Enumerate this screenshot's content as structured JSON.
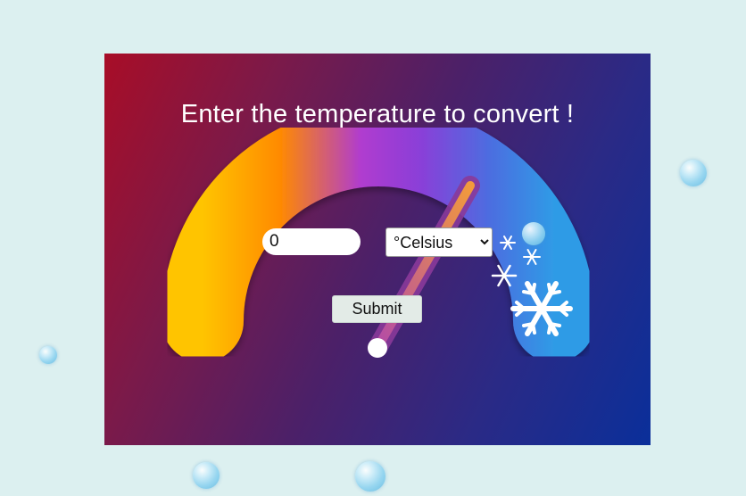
{
  "page": {
    "title": "Enter the temperature to convert !"
  },
  "form": {
    "temperature_value": "0",
    "unit_selected": "°Celsius",
    "unit_options": [
      "°Celsius"
    ],
    "submit_label": "Submit"
  },
  "colors": {
    "background": "#dcf0f0",
    "panel_start": "#a80d27",
    "panel_end": "#0a2f9a",
    "gauge_warm": "#ffc400",
    "gauge_mid": "#9b3bd6",
    "gauge_cold": "#3a8ee6"
  },
  "icons": [
    "snowflake-icon",
    "bubble"
  ]
}
